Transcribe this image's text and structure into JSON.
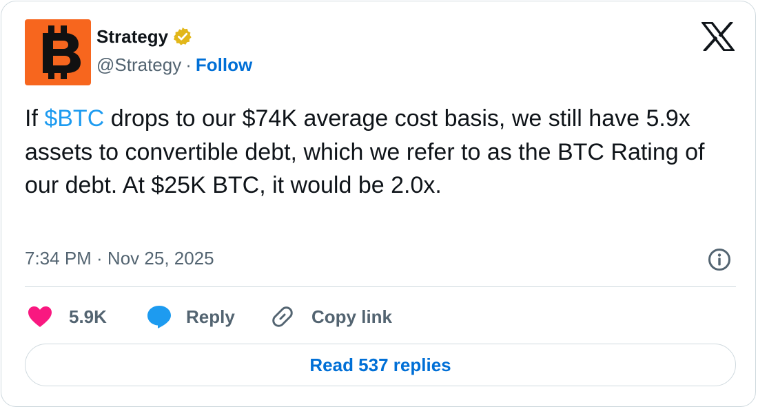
{
  "author": {
    "display_name": "Strategy",
    "handle": "@Strategy",
    "separator": "·",
    "follow_label": "Follow",
    "verified": true,
    "avatar_icon": "bitcoin-b-icon",
    "avatar_bg": "#f7661e"
  },
  "tweet": {
    "text_before": "If ",
    "cashtag": "$BTC",
    "text_after": " drops to our $74K average cost basis, we still have 5.9x assets to convertible debt, which we refer to as the BTC Rating of our debt. At $25K BTC, it would be 2.0x.",
    "timestamp": "7:34 PM · Nov 25, 2025"
  },
  "actions": {
    "like_count": "5.9K",
    "reply_label": "Reply",
    "copy_link_label": "Copy link"
  },
  "footer": {
    "read_replies_label": "Read 537 replies"
  },
  "colors": {
    "link_blue": "#006fd6",
    "cashtag_blue": "#1d9bf0",
    "like_pink": "#f91880",
    "reply_blue": "#1d9bf0",
    "verified_gold": "#e2b719",
    "muted_text": "#536471",
    "border": "#cfd9de"
  }
}
